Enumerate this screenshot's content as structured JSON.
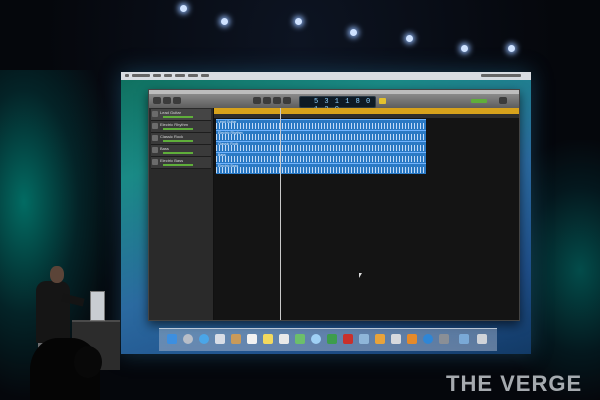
{
  "watermark": {
    "text": "THE VERGE"
  },
  "garageband": {
    "lcd": {
      "display": "5 3 1 1 8 0 1 2 0"
    },
    "tracks": [
      {
        "name": "Lead Guitar"
      },
      {
        "name": "Electric Rhythm"
      },
      {
        "name": "Classic Rock"
      },
      {
        "name": "Bass"
      },
      {
        "name": "Electric Bass"
      }
    ],
    "regions": [
      {
        "name": "Lead Guitar"
      },
      {
        "name": "Electric Rhythm"
      },
      {
        "name": "Classic Rock"
      },
      {
        "name": "Bass"
      },
      {
        "name": "Electric Bass"
      }
    ]
  },
  "colors": {
    "region_blue": "#2a79c4",
    "ruler_yellow": "#d7a21c",
    "stage_glow": "#00bea9"
  },
  "dock": {
    "icons": [
      "finder-icon",
      "launchpad-icon",
      "safari-icon",
      "mail-icon",
      "contacts-icon",
      "calendar-icon",
      "notes-icon",
      "reminders-icon",
      "maps-icon",
      "messages-icon",
      "facetime-icon",
      "photo-booth-icon",
      "iphoto-icon",
      "garageband-icon",
      "itunes-icon",
      "ibooks-icon",
      "app-store-icon",
      "system-preferences-icon",
      "downloads-icon",
      "trash-icon"
    ]
  }
}
